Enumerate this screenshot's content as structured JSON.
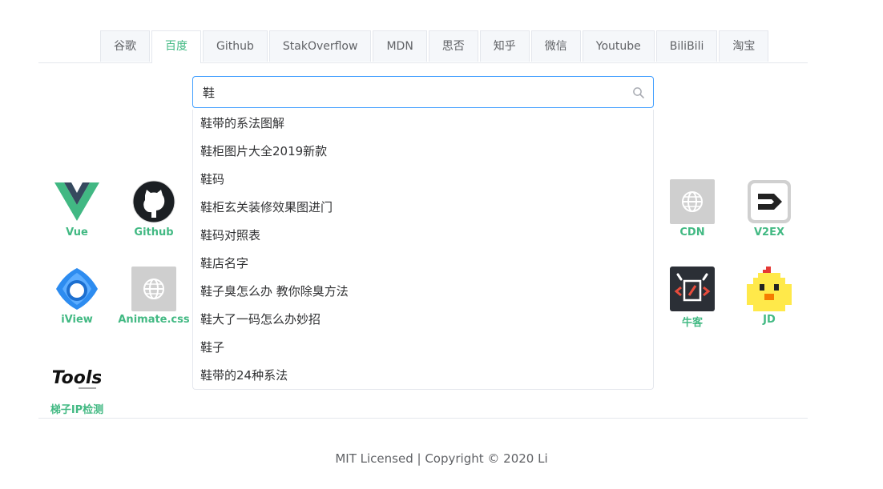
{
  "tabs": [
    {
      "label": "谷歌",
      "active": false
    },
    {
      "label": "百度",
      "active": true
    },
    {
      "label": "Github",
      "active": false
    },
    {
      "label": "StakOverflow",
      "active": false
    },
    {
      "label": "MDN",
      "active": false
    },
    {
      "label": "思否",
      "active": false
    },
    {
      "label": "知乎",
      "active": false
    },
    {
      "label": "微信",
      "active": false
    },
    {
      "label": "Youtube",
      "active": false
    },
    {
      "label": "BiliBili",
      "active": false
    },
    {
      "label": "淘宝",
      "active": false
    }
  ],
  "search": {
    "value": "鞋",
    "icon": "search-icon"
  },
  "suggestions": [
    "鞋带的系法图解",
    "鞋柜图片大全2019新款",
    "鞋码",
    "鞋柜玄关装修效果图进门",
    "鞋码对照表",
    "鞋店名字",
    "鞋子臭怎么办 教你除臭方法",
    "鞋大了一码怎么办妙招",
    "鞋子",
    "鞋带的24种系法"
  ],
  "sites": {
    "vue": {
      "label": "Vue",
      "icon": "vue-logo-icon"
    },
    "github": {
      "label": "Github",
      "icon": "github-logo-icon"
    },
    "cdn": {
      "label": "CDN",
      "icon": "globe-icon"
    },
    "v2ex": {
      "label": "V2EX",
      "icon": "v2ex-logo-icon"
    },
    "iview": {
      "label": "iView",
      "icon": "iview-logo-icon"
    },
    "animate": {
      "label": "Animate.css",
      "icon": "globe-icon"
    },
    "nowcoder": {
      "label": "牛客",
      "icon": "nowcoder-logo-icon"
    },
    "jd": {
      "label": "JD",
      "icon": "jd-mascot-icon"
    },
    "tools": {
      "label": "梯子IP检测",
      "icon": "tools-logo-icon",
      "logo_text": "Tools"
    }
  },
  "footer": "MIT Licensed | Copyright © 2020 Li",
  "colors": {
    "accent": "#42b983",
    "focus_border": "#409eff"
  }
}
